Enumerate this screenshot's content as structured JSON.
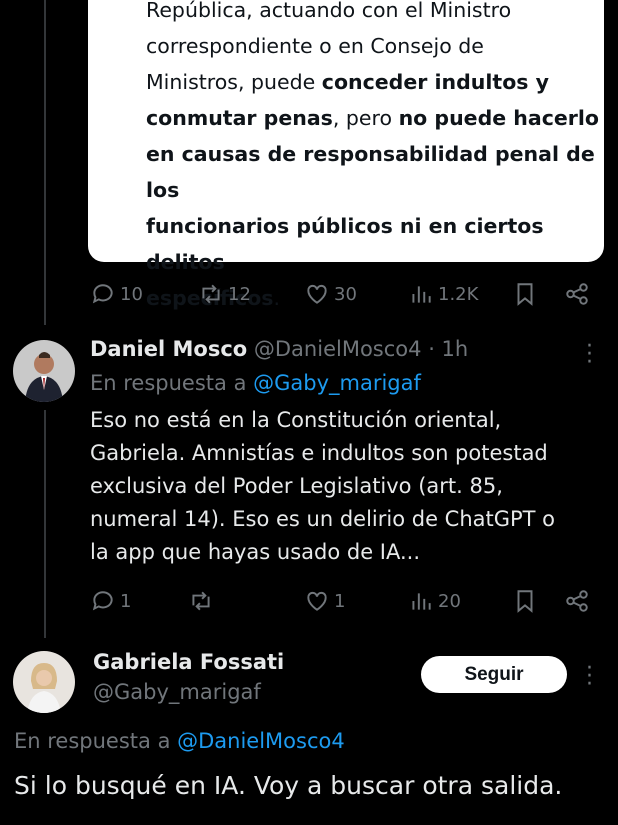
{
  "quoted_card": {
    "line1": "República, actuando con el Ministro",
    "line2": "correspondiente o en Consejo de",
    "line3_a": "Ministros, puede ",
    "line3_b": "conceder indultos y",
    "line4_a": "conmutar penas",
    "line4_b": ", pero ",
    "line4_c": "no puede hacerlo",
    "line5": "en causas de responsabilidad penal de los",
    "line6": "funcionarios públicos ni en ciertos delitos",
    "line7": "específicos",
    "line7_end": "."
  },
  "tweet1_actions": {
    "replies": "10",
    "retweets": "12",
    "likes": "30",
    "views": "1.2K"
  },
  "tweet2": {
    "name": "Daniel Mosco",
    "handle": "@DanielMosco4",
    "time": "· 1h",
    "reply_prefix": "En respuesta a ",
    "reply_to": "@Gaby_marigaf",
    "text_lines": [
      "Eso no está en la Constitución oriental,",
      "Gabriela. Amnistías e indultos son potestad",
      "exclusiva del Poder Legislativo (art. 85,",
      "numeral 14). Eso es un delirio de ChatGPT o",
      "la app que hayas usado de IA..."
    ],
    "actions": {
      "replies": "1",
      "retweets": "",
      "likes": "1",
      "views": "20"
    }
  },
  "tweet3": {
    "name": "Gabriela Fossati",
    "handle": "@Gaby_marigaf",
    "follow_label": "Seguir",
    "reply_prefix": "En respuesta a ",
    "reply_to": "@DanielMosco4",
    "text": "Si lo busqué en IA. Voy a buscar otra salida."
  },
  "icons": [
    "reply-icon",
    "retweet-icon",
    "like-icon",
    "views-icon",
    "bookmark-icon",
    "share-icon",
    "more-icon"
  ]
}
